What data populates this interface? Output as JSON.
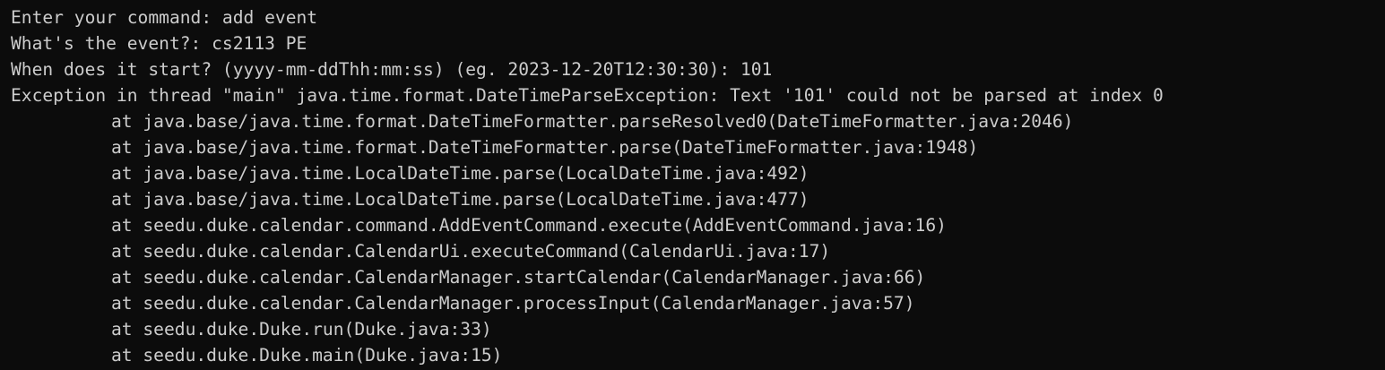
{
  "terminal": {
    "background": "#0c0c0c",
    "foreground": "#cccccc",
    "lines": [
      "Enter your command: add event",
      "What's the event?: cs2113 PE",
      "When does it start? (yyyy-mm-ddThh:mm:ss) (eg. 2023-12-20T12:30:30): 101",
      "Exception in thread \"main\" java.time.format.DateTimeParseException: Text '101' could not be parsed at index 0"
    ],
    "stack_trace": [
      "at java.base/java.time.format.DateTimeFormatter.parseResolved0(DateTimeFormatter.java:2046)",
      "at java.base/java.time.format.DateTimeFormatter.parse(DateTimeFormatter.java:1948)",
      "at java.base/java.time.LocalDateTime.parse(LocalDateTime.java:492)",
      "at java.base/java.time.LocalDateTime.parse(LocalDateTime.java:477)",
      "at seedu.duke.calendar.command.AddEventCommand.execute(AddEventCommand.java:16)",
      "at seedu.duke.calendar.CalendarUi.executeCommand(CalendarUi.java:17)",
      "at seedu.duke.calendar.CalendarManager.startCalendar(CalendarManager.java:66)",
      "at seedu.duke.calendar.CalendarManager.processInput(CalendarManager.java:57)",
      "at seedu.duke.Duke.run(Duke.java:33)",
      "at seedu.duke.Duke.main(Duke.java:15)"
    ]
  }
}
